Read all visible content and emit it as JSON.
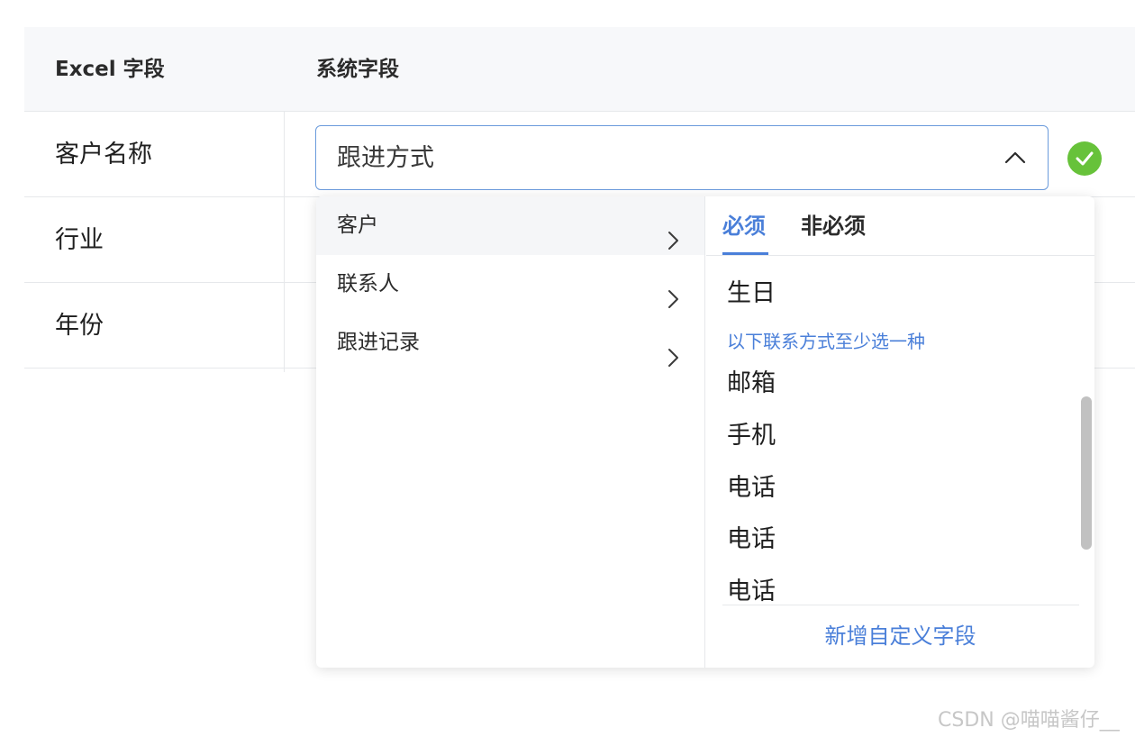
{
  "table": {
    "headers": [
      "Excel 字段",
      "系统字段"
    ],
    "rows": [
      {
        "excel_field": "客户名称"
      },
      {
        "excel_field": "行业"
      },
      {
        "excel_field": "年份"
      }
    ]
  },
  "select": {
    "value": "跟进方式"
  },
  "dropdown": {
    "categories": [
      {
        "label": "客户"
      },
      {
        "label": "联系人"
      },
      {
        "label": "跟进记录"
      }
    ],
    "tabs": [
      {
        "label": "必须"
      },
      {
        "label": "非必须"
      }
    ],
    "fields_top": [
      "生日"
    ],
    "hint": "以下联系方式至少选一种",
    "fields_contact": [
      "邮箱",
      "手机",
      "电话",
      "电话",
      "电话"
    ],
    "footer": "新增自定义字段"
  },
  "watermark": "CSDN @喵喵酱仔__",
  "colors": {
    "accent": "#4a7fd9",
    "success": "#67c23a",
    "header_bg": "#f7f8fa"
  }
}
